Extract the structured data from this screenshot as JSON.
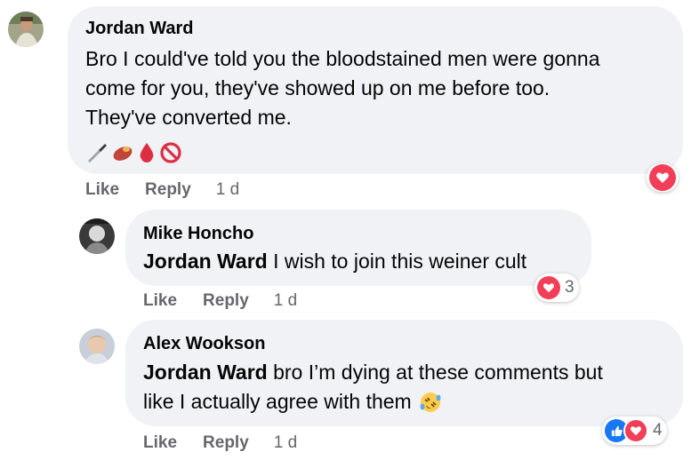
{
  "comments": [
    {
      "author": "Jordan Ward",
      "text_lines": [
        "Bro I could've told you the bloodstained men were gonna",
        "come for you, they've showed up on me before too.",
        "They've converted me."
      ],
      "emojis": [
        "knife-icon",
        "sweet-potato-icon",
        "drop-of-blood-icon",
        "prohibited-icon"
      ],
      "actions": {
        "like": "Like",
        "reply": "Reply",
        "time": "1 d"
      },
      "reaction": {
        "type": "love"
      }
    },
    {
      "author": "Mike Honcho",
      "mention": "Jordan Ward",
      "text": " I wish to join this weiner cult",
      "actions": {
        "like": "Like",
        "reply": "Reply",
        "time": "1 d"
      },
      "reaction": {
        "type": "love",
        "count": "3"
      }
    },
    {
      "author": "Alex Wookson",
      "mention": "Jordan Ward",
      "text_line1": " bro I’m dying at these comments but",
      "text_line2": "like I actually agree with them",
      "emoji": "rolling-on-floor-laughing-icon",
      "actions": {
        "like": "Like",
        "reply": "Reply",
        "time": "1 d"
      },
      "reaction": {
        "types": [
          "like",
          "love"
        ],
        "count": "4"
      }
    }
  ],
  "colors": {
    "bubble": "#f0f2f5",
    "love": "#f33e58",
    "like": "#1877f2",
    "muted": "#65676b"
  }
}
